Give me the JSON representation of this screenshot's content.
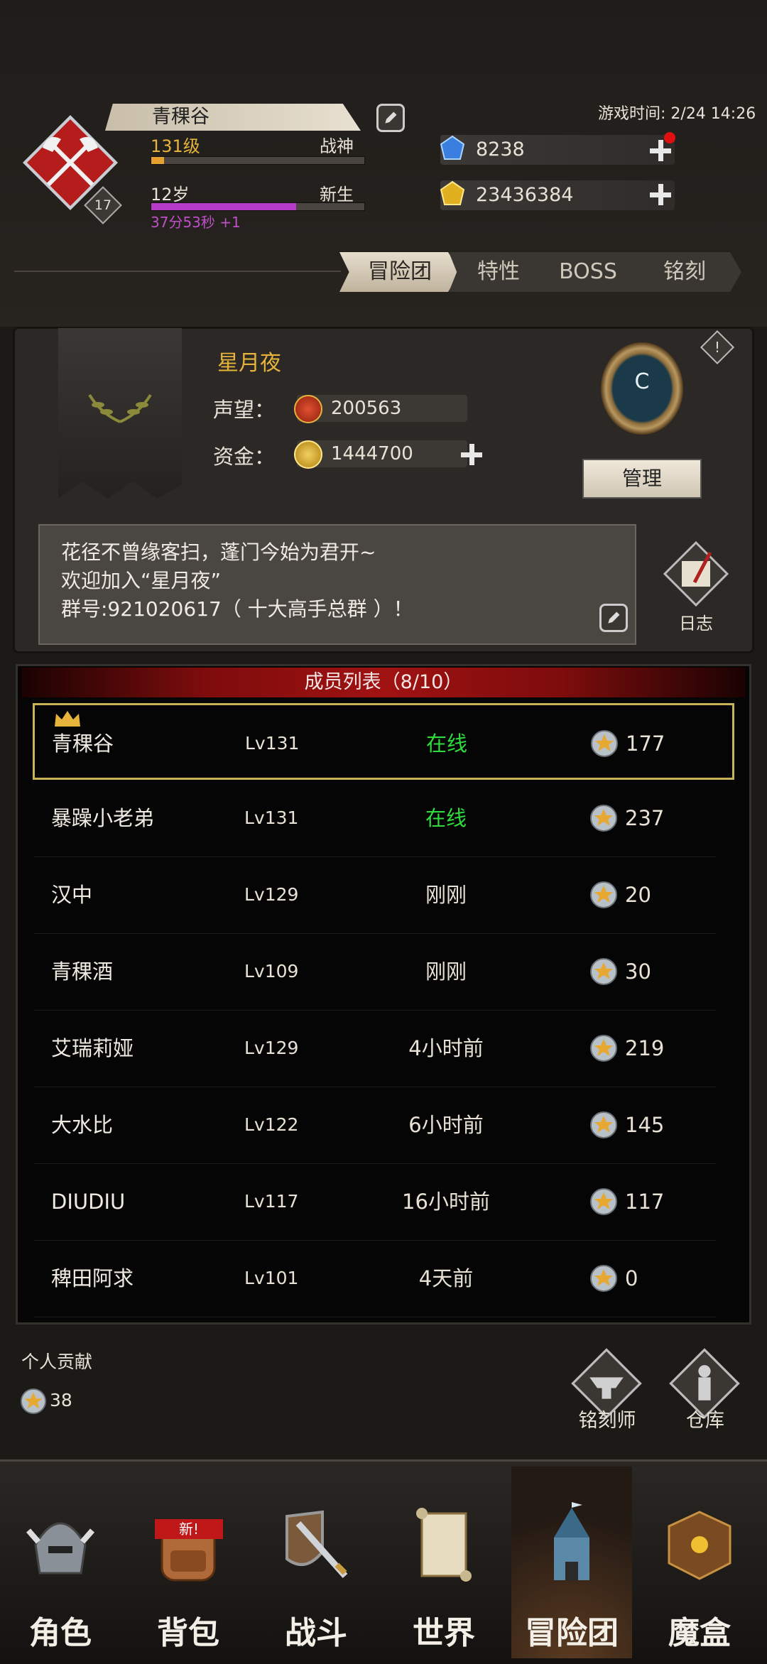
{
  "header": {
    "player_name": "青稞谷",
    "badge_level": "17",
    "level_text": "131级",
    "title": "战神",
    "age_text": "12岁",
    "age_status": "新生",
    "timer_text": "37分53秒 +1",
    "game_time": "游戏时间: 2/24 14:26",
    "gems": "8238",
    "gold": "23436384",
    "exp_progress": 0.06,
    "age_progress": 0.68
  },
  "tabs": [
    {
      "label": "冒险团",
      "active": true
    },
    {
      "label": "特性",
      "active": false
    },
    {
      "label": "BOSS",
      "active": false
    },
    {
      "label": "铭刻",
      "active": false
    }
  ],
  "guild": {
    "name": "星月夜",
    "reputation_label": "声望：",
    "reputation": "200563",
    "funds_label": "资金：",
    "funds": "1444700",
    "rank_letter": "C",
    "manage_label": "管理",
    "notice": "花径不曾缘客扫，蓬门今始为君开~\n欢迎加入“星月夜”\n群号:921020617（ 十大高手总群 ）！",
    "log_label": "日志"
  },
  "members": {
    "header": "成员列表（8/10）",
    "rows": [
      {
        "name": "青稞谷",
        "level": "Lv131",
        "status": "在线",
        "points": "177",
        "online": true,
        "leader": true
      },
      {
        "name": "暴躁小老弟",
        "level": "Lv131",
        "status": "在线",
        "points": "237",
        "online": true,
        "leader": false
      },
      {
        "name": "汉中",
        "level": "Lv129",
        "status": "刚刚",
        "points": "20",
        "online": false,
        "leader": false
      },
      {
        "name": "青稞酒",
        "level": "Lv109",
        "status": "刚刚",
        "points": "30",
        "online": false,
        "leader": false
      },
      {
        "name": "艾瑞莉娅",
        "level": "Lv129",
        "status": "4小时前",
        "points": "219",
        "online": false,
        "leader": false
      },
      {
        "name": "大水比",
        "level": "Lv122",
        "status": "6小时前",
        "points": "145",
        "online": false,
        "leader": false
      },
      {
        "name": "DIUDIU",
        "level": "Lv117",
        "status": "16小时前",
        "points": "117",
        "online": false,
        "leader": false
      },
      {
        "name": "稗田阿求",
        "level": "Lv101",
        "status": "4天前",
        "points": "0",
        "online": false,
        "leader": false
      }
    ]
  },
  "contribution": {
    "label": "个人贡献",
    "value": "38"
  },
  "shortcuts": {
    "engraver": "铭刻师",
    "warehouse": "仓库"
  },
  "nav": [
    {
      "label": "角色",
      "icon": "helmet-icon"
    },
    {
      "label": "背包",
      "icon": "backpack-icon",
      "badge": "新!"
    },
    {
      "label": "战斗",
      "icon": "sword-shield-icon"
    },
    {
      "label": "世界",
      "icon": "scroll-map-icon"
    },
    {
      "label": "冒险团",
      "icon": "castle-icon",
      "active": true
    },
    {
      "label": "魔盒",
      "icon": "magic-box-icon"
    }
  ],
  "colors": {
    "online": "#2fdc3c",
    "accent_gold": "#e6b43c",
    "guild_name": "#e6b43c",
    "age_bar": "#b43cc8"
  }
}
